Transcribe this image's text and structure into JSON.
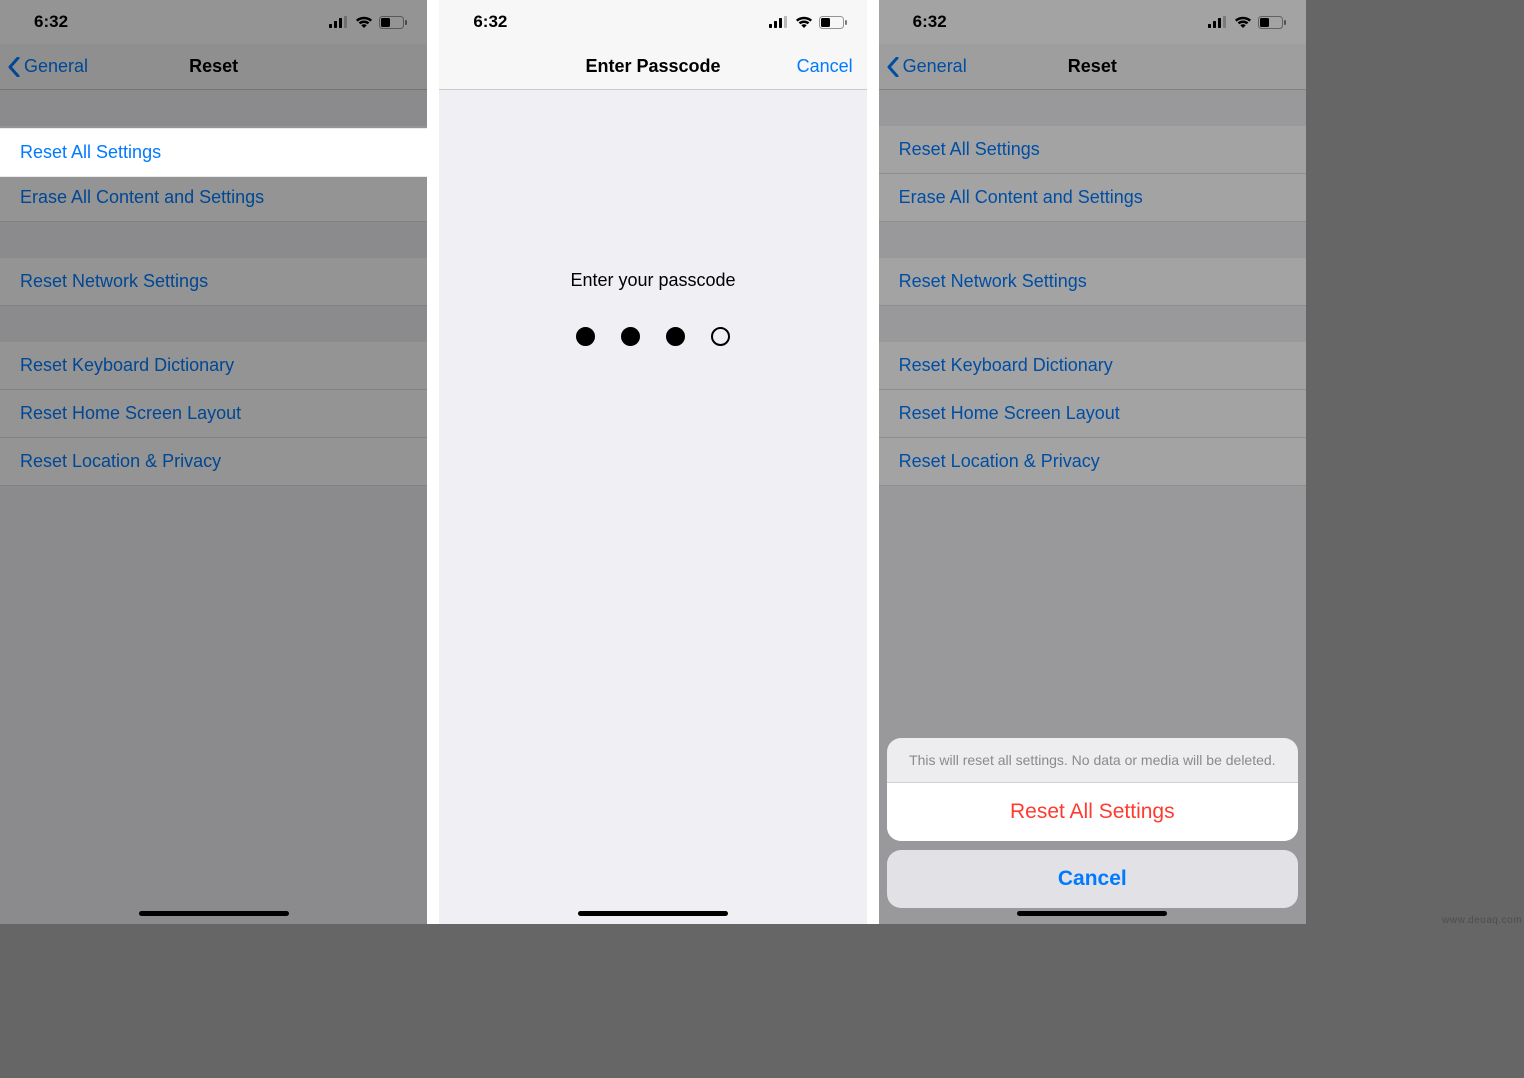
{
  "status": {
    "time": "6:32"
  },
  "panel1": {
    "back": "General",
    "title": "Reset",
    "rows": {
      "r0": "Reset All Settings",
      "r1": "Erase All Content and Settings",
      "r2": "Reset Network Settings",
      "r3": "Reset Keyboard Dictionary",
      "r4": "Reset Home Screen Layout",
      "r5": "Reset Location & Privacy"
    }
  },
  "panel2": {
    "title": "Enter Passcode",
    "cancel": "Cancel",
    "prompt": "Enter your passcode",
    "dots_filled": 3,
    "dots_total": 4
  },
  "panel3": {
    "back": "General",
    "title": "Reset",
    "rows": {
      "r0": "Reset All Settings",
      "r1": "Erase All Content and Settings",
      "r2": "Reset Network Settings",
      "r3": "Reset Keyboard Dictionary",
      "r4": "Reset Home Screen Layout",
      "r5": "Reset Location & Privacy"
    },
    "sheet": {
      "header": "This will reset all settings. No data or media will be deleted.",
      "confirm": "Reset All Settings",
      "cancel": "Cancel"
    }
  },
  "watermark": "www.deuaq.com"
}
